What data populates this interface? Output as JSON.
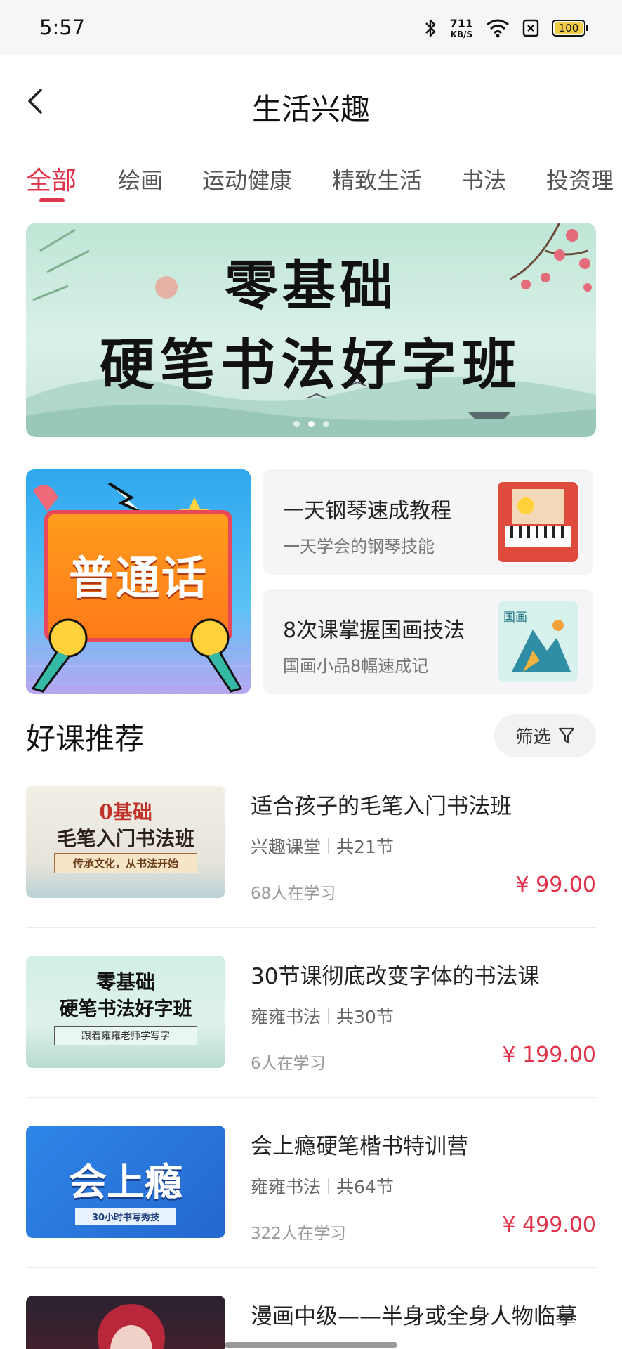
{
  "status_bar": {
    "time": "5:57",
    "net_speed_value": "711",
    "net_speed_unit": "KB/S",
    "battery": "100"
  },
  "header": {
    "title": "生活兴趣"
  },
  "tabs": [
    {
      "label": "全部",
      "active": true
    },
    {
      "label": "绘画",
      "active": false
    },
    {
      "label": "运动健康",
      "active": false
    },
    {
      "label": "精致生活",
      "active": false
    },
    {
      "label": "书法",
      "active": false
    },
    {
      "label": "投资理",
      "active": false
    }
  ],
  "banner": {
    "line1": "零基础",
    "line2": "硬笔书法好字班",
    "page_count": 3,
    "current_page": 2
  },
  "features": {
    "big_card_text": "普通话",
    "cards": [
      {
        "title": "一天钢琴速成教程",
        "subtitle": "一天学会的钢琴技能"
      },
      {
        "title": "8次课掌握国画技法",
        "subtitle": "国画小品8幅速成记",
        "thumb_label": "国画"
      }
    ]
  },
  "section": {
    "title": "好课推荐",
    "filter_label": "筛选"
  },
  "courses": [
    {
      "title": "适合孩子的毛笔入门书法班",
      "provider": "兴趣课堂",
      "lessons": "共21节",
      "learners": "68人在学习",
      "price": "¥ 99.00",
      "thumb_line1": "0基础",
      "thumb_line2": "毛笔入门书法班",
      "thumb_line3": "传承文化，从书法开始"
    },
    {
      "title": "30节课彻底改变字体的书法课",
      "provider": "雍雍书法",
      "lessons": "共30节",
      "learners": "6人在学习",
      "price": "¥ 199.00",
      "thumb_line1": "零基础",
      "thumb_line2": "硬笔书法好字班",
      "thumb_line3": "跟着雍雍老师学写字"
    },
    {
      "title": "会上瘾硬笔楷书特训营",
      "provider": "雍雍书法",
      "lessons": "共64节",
      "learners": "322人在学习",
      "price": "¥ 499.00",
      "thumb_line1": "会上瘾",
      "thumb_line2": "30小时书写秀技"
    },
    {
      "title": "漫画中级——半身或全身人物临摹"
    }
  ],
  "colors": {
    "accent": "#e1344a",
    "banner_bg": "#cdeadf",
    "course3_bg": "#2f7de0"
  }
}
